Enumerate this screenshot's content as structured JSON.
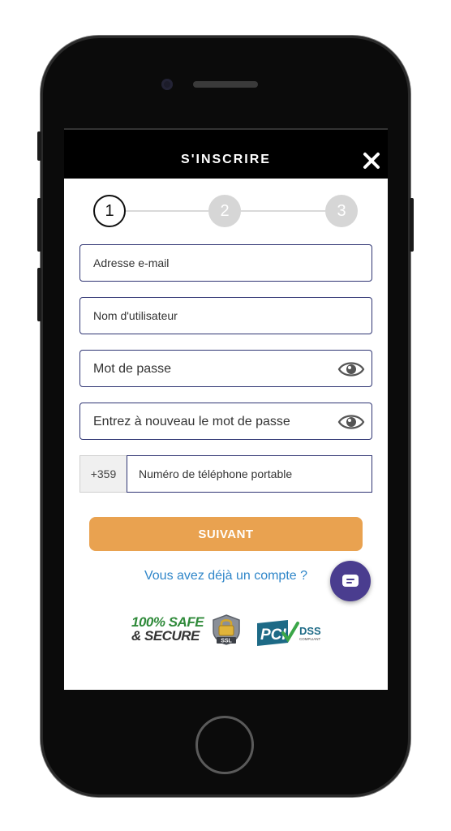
{
  "header": {
    "title": "S'INSCRIRE"
  },
  "stepper": {
    "steps": [
      "1",
      "2",
      "3"
    ],
    "active_step": 1
  },
  "form": {
    "email_placeholder": "Adresse e-mail",
    "username_placeholder": "Nom d'utilisateur",
    "password_placeholder": "Mot de passe",
    "confirm_password_placeholder": "Entrez à nouveau le mot de passe",
    "phone_prefix": "+359",
    "phone_placeholder": "Numéro de téléphone portable"
  },
  "actions": {
    "next_label": "SUIVANT",
    "login_link": "Vous avez déjà un compte ?"
  },
  "badges": {
    "safe_line1": "100% SAFE",
    "safe_line2": "& SECURE",
    "ssl_label": "SSL",
    "pci_label": "PCI",
    "dss_label": "DSS",
    "dss_sub": "COMPLIANT"
  },
  "colors": {
    "accent_button": "#e9a250",
    "link": "#2f86c9",
    "field_border": "#2f3573",
    "chat_bubble": "#4a3d8f"
  },
  "icons": {
    "close": "close-icon",
    "password_toggle": "eye-icon",
    "chat": "chat-icon"
  }
}
